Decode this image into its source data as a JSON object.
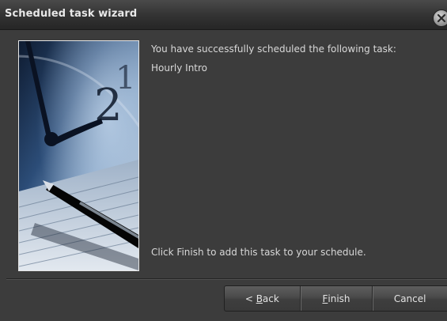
{
  "window": {
    "title": "Scheduled task wizard"
  },
  "messages": {
    "success": "You have successfully scheduled the following task:",
    "task_name": "Hourly Intro",
    "instruction": "Click Finish to add this task to your schedule."
  },
  "buttons": {
    "back": {
      "mnemonic": "B",
      "rest": "ack",
      "prefix": "< "
    },
    "finish": {
      "mnemonic": "F",
      "rest": "inish"
    },
    "cancel": {
      "label": "Cancel"
    }
  },
  "icons": {
    "close": "close-icon",
    "side_image": "clock-and-pen-image"
  }
}
